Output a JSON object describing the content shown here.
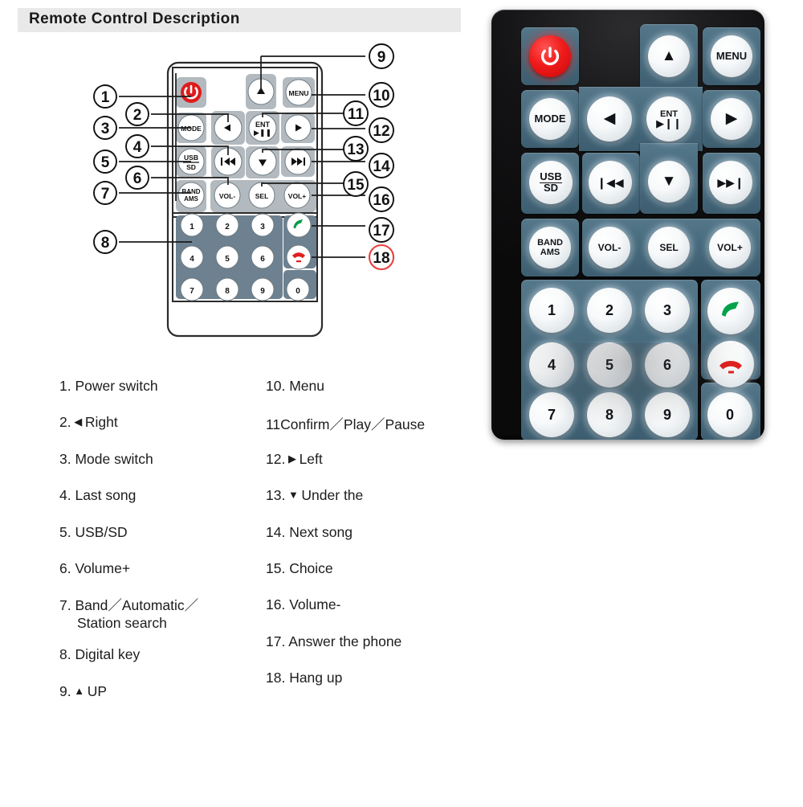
{
  "header": {
    "title": "Remote Control Description"
  },
  "colors": {
    "title_bar_bg": "#e9e9e9",
    "power_red": "#e01b1b",
    "photo_body_black": "#131315",
    "photo_pad_teal": "#466a7c",
    "diagram_pad_gray": "#b2babf",
    "diagram_keypad_slate": "#6d8190",
    "callout_18_ring_red": "#e8403f",
    "answer_green": "#00a24a",
    "hangup_red": "#e02020",
    "button_white": "#f5f8fa"
  },
  "remote": {
    "name": "ir-remote-control",
    "rows": [
      {
        "id": "row-1",
        "buttons": [
          {
            "name": "power-button",
            "label": "⏻",
            "icon": "power-icon",
            "shape": "circle",
            "color": "red"
          },
          {
            "name": "up-button",
            "label": "▲",
            "icon": "triangle-up-icon",
            "shape": "circle",
            "color": "white"
          },
          {
            "name": "menu-button",
            "label": "MENU",
            "icon": "menu-label",
            "shape": "circle",
            "color": "white"
          }
        ]
      },
      {
        "id": "row-2",
        "buttons": [
          {
            "name": "mode-button",
            "label": "MODE",
            "icon": "mode-label",
            "shape": "circle",
            "color": "white"
          },
          {
            "name": "left-button",
            "label": "◀",
            "icon": "triangle-left-icon",
            "shape": "circle",
            "color": "white"
          },
          {
            "name": "enter-play-pause-button",
            "label": "ENT",
            "sublabel": "▶❙❙",
            "icon": "play-pause-icon",
            "shape": "circle",
            "color": "white"
          },
          {
            "name": "right-button",
            "label": "▶",
            "icon": "triangle-right-icon",
            "shape": "circle",
            "color": "white"
          }
        ]
      },
      {
        "id": "row-3",
        "buttons": [
          {
            "name": "usb-sd-button",
            "label": "USB",
            "sublabel": "SD",
            "icon": "usb-sd-label",
            "shape": "circle",
            "color": "white"
          },
          {
            "name": "previous-track-button",
            "label": "❙◀◀",
            "icon": "previous-track-icon",
            "shape": "circle",
            "color": "white"
          },
          {
            "name": "down-button",
            "label": "▼",
            "icon": "triangle-down-icon",
            "shape": "circle",
            "color": "white"
          },
          {
            "name": "next-track-button",
            "label": "▶▶❙",
            "icon": "next-track-icon",
            "shape": "circle",
            "color": "white"
          }
        ]
      },
      {
        "id": "row-4",
        "buttons": [
          {
            "name": "band-ams-button",
            "label": "BAND",
            "sublabel": "AMS",
            "icon": "band-ams-label",
            "shape": "circle",
            "color": "white"
          },
          {
            "name": "volume-down-button",
            "label": "VOL-",
            "icon": "volume-down-label",
            "shape": "circle",
            "color": "white"
          },
          {
            "name": "select-button",
            "label": "SEL",
            "icon": "select-label",
            "shape": "circle",
            "color": "white"
          },
          {
            "name": "volume-up-button",
            "label": "VOL+",
            "icon": "volume-up-label",
            "shape": "circle",
            "color": "white"
          }
        ]
      },
      {
        "id": "row-5",
        "buttons": [
          {
            "name": "digit-1-button",
            "label": "1",
            "shape": "circle",
            "color": "white"
          },
          {
            "name": "digit-2-button",
            "label": "2",
            "shape": "circle",
            "color": "white"
          },
          {
            "name": "digit-3-button",
            "label": "3",
            "shape": "circle",
            "color": "white"
          },
          {
            "name": "answer-call-button",
            "label": "",
            "icon": "phone-answer-icon",
            "shape": "circle",
            "color": "green"
          }
        ]
      },
      {
        "id": "row-6",
        "buttons": [
          {
            "name": "digit-4-button",
            "label": "4",
            "shape": "circle",
            "color": "white"
          },
          {
            "name": "digit-5-button",
            "label": "5",
            "shape": "circle",
            "color": "white"
          },
          {
            "name": "digit-6-button",
            "label": "6",
            "shape": "circle",
            "color": "white"
          },
          {
            "name": "hang-up-button",
            "label": "",
            "icon": "phone-hangup-icon",
            "shape": "circle",
            "color": "red"
          }
        ]
      },
      {
        "id": "row-7",
        "buttons": [
          {
            "name": "digit-7-button",
            "label": "7",
            "shape": "circle",
            "color": "white"
          },
          {
            "name": "digit-8-button",
            "label": "8",
            "shape": "circle",
            "color": "white"
          },
          {
            "name": "digit-9-button",
            "label": "9",
            "shape": "circle",
            "color": "white"
          },
          {
            "name": "digit-0-button",
            "label": "0",
            "shape": "circle",
            "color": "white"
          }
        ]
      }
    ],
    "button_labels": {
      "power": "⏻",
      "menu": "MENU",
      "mode": "MODE",
      "usb": "USB",
      "sd": "SD",
      "band": "BAND",
      "ams": "AMS",
      "ent": "ENT",
      "play_pause": "▶❙❙",
      "sel": "SEL",
      "vol_down": "VOL-",
      "vol_up": "VOL+",
      "prev": "❙◀◀",
      "next": "▶▶❙",
      "up": "▲",
      "down": "▼",
      "left": "◀",
      "right": "▶",
      "d1": "1",
      "d2": "2",
      "d3": "3",
      "d4": "4",
      "d5": "5",
      "d6": "6",
      "d7": "7",
      "d8": "8",
      "d9": "9",
      "d0": "0"
    }
  },
  "callouts": {
    "left": [
      "1",
      "2",
      "3",
      "4",
      "5",
      "6",
      "7",
      "8"
    ],
    "right": [
      "9",
      "10",
      "11",
      "12",
      "13",
      "14",
      "15",
      "16",
      "17",
      "18"
    ],
    "highlighted": "18"
  },
  "description": {
    "left_column": [
      {
        "num": "1.",
        "text": "Power switch",
        "arrow": ""
      },
      {
        "num": "2.",
        "text": "Right",
        "arrow": "◀"
      },
      {
        "num": "3.",
        "text": "Mode switch",
        "arrow": ""
      },
      {
        "num": "4.",
        "text": "Last song",
        "arrow": ""
      },
      {
        "num": "5.",
        "text": "USB/SD",
        "arrow": ""
      },
      {
        "num": "6.",
        "text": "Volume+",
        "arrow": ""
      },
      {
        "num": "7.",
        "text": "Band／Automatic／",
        "text2": "Station search",
        "arrow": ""
      },
      {
        "num": "8.",
        "text": "Digital key",
        "arrow": ""
      },
      {
        "num": "9.",
        "text": "UP",
        "arrow": "▲"
      }
    ],
    "right_column": [
      {
        "num": "10.",
        "text": "Menu",
        "arrow": ""
      },
      {
        "num": "11",
        "text": "Confirm／Play／Pause",
        "arrow": "",
        "nospace": true
      },
      {
        "num": "12.",
        "text": "Left",
        "arrow": "▶"
      },
      {
        "num": "13.",
        "text": "Under the",
        "arrow": "▼"
      },
      {
        "num": "14.",
        "text": "Next song",
        "arrow": ""
      },
      {
        "num": "15.",
        "text": "Choice",
        "arrow": ""
      },
      {
        "num": "16.",
        "text": "Volume-",
        "arrow": ""
      },
      {
        "num": "17.",
        "text": "Answer the phone",
        "arrow": ""
      },
      {
        "num": "18.",
        "text": "Hang up",
        "arrow": ""
      }
    ]
  }
}
